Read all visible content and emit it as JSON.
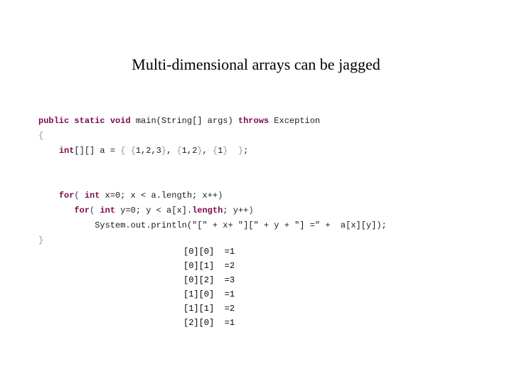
{
  "slide": {
    "title": "Multi-dimensional arrays can be jagged",
    "background_color": "#ffffff",
    "title_color": "#000000"
  },
  "theme": {
    "keyword_color": "#7a0a4e",
    "plain_code_color": "#1a1a1a",
    "string_color": "#151533",
    "brace_color": "#8f9b8f",
    "output_color": "#000000"
  },
  "code": {
    "language": "java",
    "lines": [
      {
        "id": "line-1",
        "tokens": [
          {
            "t": "public",
            "k": "kw"
          },
          {
            "t": " ",
            "k": "plain"
          },
          {
            "t": "static",
            "k": "kw"
          },
          {
            "t": " ",
            "k": "plain"
          },
          {
            "t": "void",
            "k": "kw"
          },
          {
            "t": " main(String[] args) ",
            "k": "plain"
          },
          {
            "t": "throws",
            "k": "kw"
          },
          {
            "t": " Exception",
            "k": "plain"
          }
        ]
      },
      {
        "id": "line-2",
        "tokens": [
          {
            "t": "{",
            "k": "brace"
          }
        ]
      },
      {
        "id": "line-3",
        "tokens": [
          {
            "t": "    ",
            "k": "plain"
          },
          {
            "t": "int",
            "k": "kw"
          },
          {
            "t": "[][] a = ",
            "k": "plain"
          },
          {
            "t": "{",
            "k": "brace"
          },
          {
            "t": " ",
            "k": "plain"
          },
          {
            "t": "{",
            "k": "brace"
          },
          {
            "t": "1,2,3",
            "k": "plain"
          },
          {
            "t": "}",
            "k": "brace"
          },
          {
            "t": ", ",
            "k": "plain"
          },
          {
            "t": "{",
            "k": "brace"
          },
          {
            "t": "1,2",
            "k": "plain"
          },
          {
            "t": "}",
            "k": "brace"
          },
          {
            "t": ", ",
            "k": "plain"
          },
          {
            "t": "{",
            "k": "brace"
          },
          {
            "t": "1",
            "k": "plain"
          },
          {
            "t": "}",
            "k": "brace"
          },
          {
            "t": "  ",
            "k": "plain"
          },
          {
            "t": "}",
            "k": "brace"
          },
          {
            "t": ";",
            "k": "plain"
          }
        ]
      },
      {
        "id": "line-4",
        "tokens": []
      },
      {
        "id": "line-5",
        "tokens": []
      },
      {
        "id": "line-6",
        "tokens": [
          {
            "t": "    ",
            "k": "plain"
          },
          {
            "t": "for",
            "k": "kw"
          },
          {
            "t": "(",
            "k": "punct"
          },
          {
            "t": " ",
            "k": "plain"
          },
          {
            "t": "int",
            "k": "kw"
          },
          {
            "t": " x=0; x < a.length; x++",
            "k": "plain"
          },
          {
            "t": ")",
            "k": "punct"
          }
        ]
      },
      {
        "id": "line-7",
        "tokens": [
          {
            "t": "       ",
            "k": "plain"
          },
          {
            "t": "for",
            "k": "kw"
          },
          {
            "t": "(",
            "k": "punct"
          },
          {
            "t": " ",
            "k": "plain"
          },
          {
            "t": "int",
            "k": "kw"
          },
          {
            "t": " y=0; y < a[x].",
            "k": "plain"
          },
          {
            "t": "length",
            "k": "kw"
          },
          {
            "t": "; y++",
            "k": "plain"
          },
          {
            "t": ")",
            "k": "punct"
          }
        ]
      },
      {
        "id": "line-8",
        "tokens": [
          {
            "t": "           System.out.println(",
            "k": "plain"
          },
          {
            "t": "\"[\"",
            "k": "str"
          },
          {
            "t": " + x+ ",
            "k": "plain"
          },
          {
            "t": "\"][\"",
            "k": "str"
          },
          {
            "t": " + y + ",
            "k": "plain"
          },
          {
            "t": "\"] =\"",
            "k": "str"
          },
          {
            "t": " +  a[x][y]);",
            "k": "plain"
          }
        ]
      },
      {
        "id": "line-9",
        "tokens": [
          {
            "t": "}",
            "k": "brace"
          }
        ]
      }
    ]
  },
  "output": {
    "lines": [
      {
        "index": "[0][0]",
        "value": "=1"
      },
      {
        "index": "[0][1]",
        "value": "=2"
      },
      {
        "index": "[0][2]",
        "value": "=3"
      },
      {
        "index": "[1][0]",
        "value": "=1"
      },
      {
        "index": "[1][1]",
        "value": "=2"
      },
      {
        "index": "[2][0]",
        "value": "=1"
      }
    ]
  }
}
